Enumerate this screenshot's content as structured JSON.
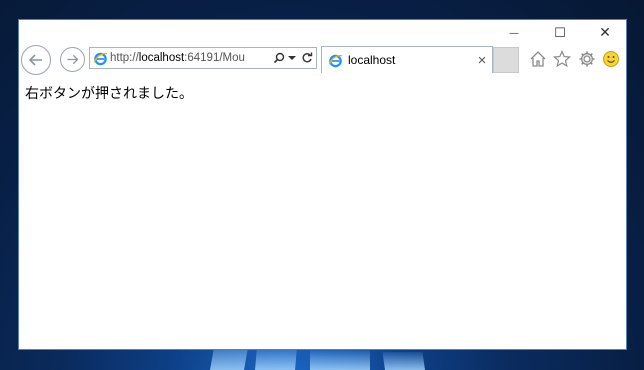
{
  "window": {
    "minimize_glyph": "—",
    "maximize_glyph": "☐",
    "close_glyph": "✕"
  },
  "nav": {
    "back_icon": "back-arrow",
    "forward_icon": "forward-arrow",
    "address_prefix": "http://",
    "address_host": "localhost",
    "address_rest": ":64191/Mou",
    "search_icon": "search",
    "dropdown_icon": "chevron-down",
    "refresh_icon": "refresh"
  },
  "tab": {
    "title": "localhost",
    "close_glyph": "×"
  },
  "toolbar": {
    "home_icon": "home",
    "favorites_icon": "star",
    "settings_icon": "gear",
    "feedback_icon": "smiley"
  },
  "page": {
    "message": "右ボタンが押されました。"
  },
  "colors": {
    "accent": "#1e90ff",
    "desktop": "#0a2b5e"
  }
}
